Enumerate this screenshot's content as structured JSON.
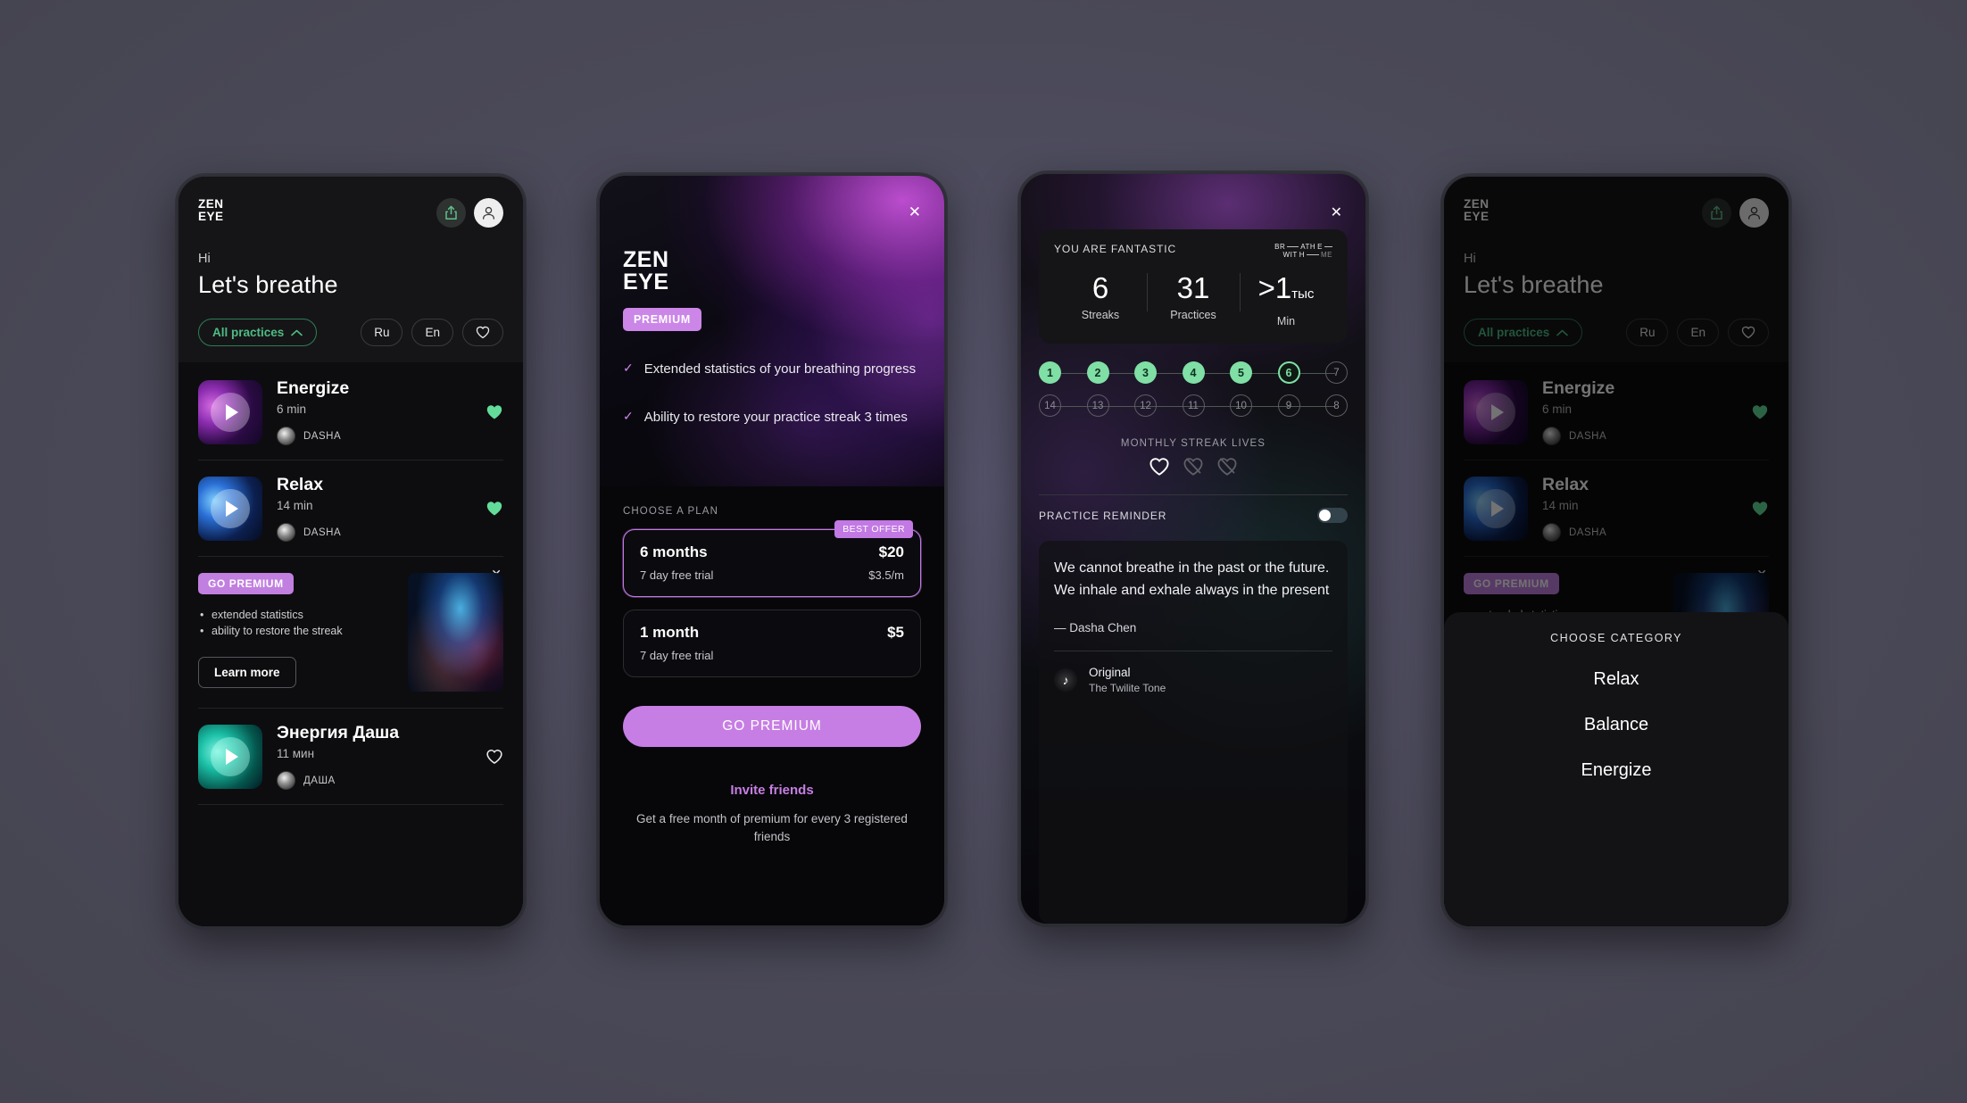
{
  "brand": {
    "line1": "ZEN",
    "line2": "EYE"
  },
  "home": {
    "greeting": "Hi",
    "headline": "Let's breathe",
    "share_icon": "share-icon",
    "profile_icon": "user-avatar-icon",
    "filters": {
      "all_practices": "All practices",
      "chevron_icon": "chevron-up-icon",
      "lang_ru": "Ru",
      "lang_en": "En",
      "favorites_icon": "heart-outline-icon"
    },
    "practices": [
      {
        "title": "Energize",
        "duration": "6 min",
        "author": "DASHA",
        "favorited": true,
        "art": "purple"
      },
      {
        "title": "Relax",
        "duration": "14 min",
        "author": "DASHA",
        "favorited": true,
        "art": "blue"
      },
      {
        "title": "Энергия Даша",
        "duration": "11 мин",
        "author": "ДАША",
        "favorited": false,
        "art": "teal"
      }
    ],
    "promo": {
      "badge": "GO PREMIUM",
      "bullets": [
        "extended statistics",
        "ability to restore the streak"
      ],
      "cta": "Learn more",
      "close_icon": "close-icon"
    }
  },
  "premium": {
    "close_icon": "close-icon",
    "badge": "PREMIUM",
    "features": [
      "Extended statistics of your breathing progress",
      "Ability to restore your practice streak 3 times"
    ],
    "plans_label": "CHOOSE A PLAN",
    "best_offer": "BEST OFFER",
    "plans": [
      {
        "name": "6 months",
        "price": "$20",
        "trial": "7 day free trial",
        "sub": "$3.5/m",
        "selected": true
      },
      {
        "name": "1 month",
        "price": "$5",
        "trial": "7 day free trial",
        "sub": "",
        "selected": false
      }
    ],
    "cta": "GO PREMIUM",
    "invite_title": "Invite friends",
    "invite_sub": "Get a free month of premium for every 3 registered friends",
    "accent": "#c77ee4"
  },
  "stats": {
    "close_icon": "close-icon",
    "card_title": "YOU ARE FANTASTIC",
    "watermark": {
      "l1a": "BR",
      "l1b": "ATH",
      "l1c": "E",
      "l2a": "WIT",
      "l2b": "H",
      "l2c": "ME"
    },
    "metrics": [
      {
        "value": "6",
        "unit": "",
        "label": "Streaks"
      },
      {
        "value": "31",
        "unit": "",
        "label": "Practices"
      },
      {
        "value": ">1",
        "unit": "тыс",
        "label": "Min"
      }
    ],
    "streak_row1": [
      {
        "n": "1",
        "state": "done"
      },
      {
        "n": "2",
        "state": "done"
      },
      {
        "n": "3",
        "state": "done"
      },
      {
        "n": "4",
        "state": "done"
      },
      {
        "n": "5",
        "state": "done"
      },
      {
        "n": "6",
        "state": "cur"
      },
      {
        "n": "7",
        "state": "off"
      }
    ],
    "streak_row2": [
      {
        "n": "14",
        "state": "off"
      },
      {
        "n": "13",
        "state": "off"
      },
      {
        "n": "12",
        "state": "off"
      },
      {
        "n": "11",
        "state": "off"
      },
      {
        "n": "10",
        "state": "off"
      },
      {
        "n": "9",
        "state": "off"
      },
      {
        "n": "8",
        "state": "off"
      }
    ],
    "lives_label": "MONTHLY STREAK LIVES",
    "lives": [
      {
        "icon": "heart-icon",
        "active": true
      },
      {
        "icon": "heart-crossed-icon",
        "active": false
      },
      {
        "icon": "heart-crossed-icon",
        "active": false
      }
    ],
    "reminder_label": "PRACTICE REMINDER",
    "reminder_on": false,
    "quote": "We cannot breathe in the past or the future. We inhale and exhale always in the present",
    "quote_author": "—  Dasha Chen",
    "track": {
      "icon": "music-note-icon",
      "name": "Original",
      "sub": "The Twilite Tone"
    },
    "accent_green": "#7fdfa5"
  },
  "category_sheet": {
    "title": "CHOOSE CATEGORY",
    "items": [
      "Relax",
      "Balance",
      "Energize"
    ]
  }
}
